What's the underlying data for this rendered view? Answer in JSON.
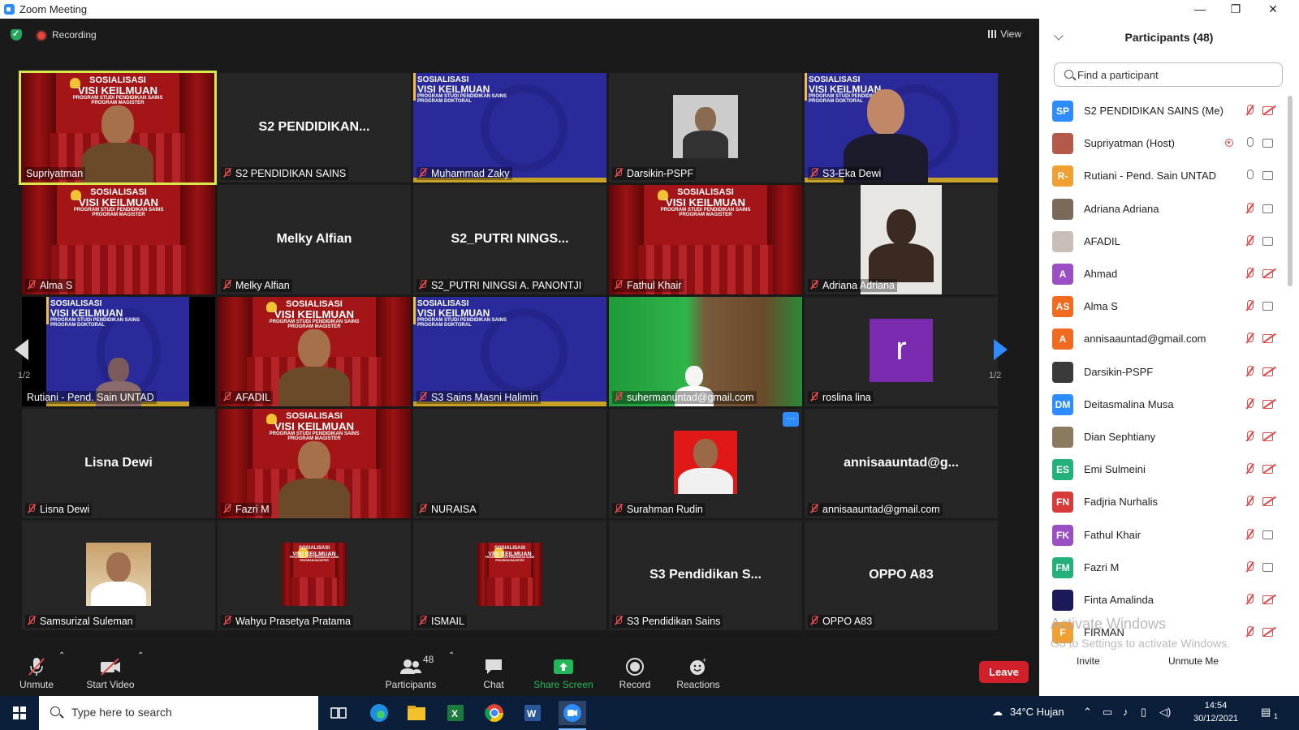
{
  "window": {
    "title": "Zoom Meeting"
  },
  "topbar": {
    "recording": "Recording",
    "view": "View"
  },
  "gallery": {
    "page_left": "1/2",
    "page_right": "1/2",
    "tiles": [
      {
        "name": "Supriyatman",
        "big": "",
        "kind": "banner-person"
      },
      {
        "name": "S2 PENDIDIKAN SAINS",
        "big": "S2  PENDIDIKAN...",
        "kind": "text"
      },
      {
        "name": "Muhammad Zaky",
        "big": "",
        "kind": "blue"
      },
      {
        "name": "Darsikin-PSPF",
        "big": "",
        "kind": "person-small"
      },
      {
        "name": "S3-Eka Dewi",
        "big": "",
        "kind": "blue-person"
      },
      {
        "name": "Alma S",
        "big": "",
        "kind": "banner"
      },
      {
        "name": "Melky Alfian",
        "big": "Melky Alfian",
        "kind": "text"
      },
      {
        "name": "S2_PUTRI NINGSI A. PANONTJI",
        "big": "S2_PUTRI  NINGS...",
        "kind": "text"
      },
      {
        "name": "Fathul Khair",
        "big": "",
        "kind": "banner"
      },
      {
        "name": "Adriana Adriana",
        "big": "",
        "kind": "person-portrait"
      },
      {
        "name": "Rutiani - Pend. Sain UNTAD",
        "big": "",
        "kind": "blue-small"
      },
      {
        "name": "AFADIL",
        "big": "",
        "kind": "banner-person"
      },
      {
        "name": "S3 Sains Masni Halimin",
        "big": "",
        "kind": "blue"
      },
      {
        "name": "suhermanuntad@gmail.com",
        "big": "",
        "kind": "green"
      },
      {
        "name": "roslina lina",
        "big": "",
        "kind": "avatar"
      },
      {
        "name": "Lisna Dewi",
        "big": "Lisna Dewi",
        "kind": "text"
      },
      {
        "name": "Fazri M",
        "big": "",
        "kind": "banner-person"
      },
      {
        "name": "NURAISA",
        "big": "",
        "kind": "empty"
      },
      {
        "name": "Surahman Rudin",
        "big": "",
        "kind": "photo-red"
      },
      {
        "name": "annisaauntad@gmail.com",
        "big": "annisaauntad@g...",
        "kind": "text"
      },
      {
        "name": "Samsurizal Suleman",
        "big": "",
        "kind": "photo-white"
      },
      {
        "name": "Wahyu Prasetya Pratama",
        "big": "",
        "kind": "banner-small"
      },
      {
        "name": "ISMAIL",
        "big": "",
        "kind": "banner-small"
      },
      {
        "name": "S3 Pendidikan Sains",
        "big": "S3  Pendidikan S...",
        "kind": "text"
      },
      {
        "name": "OPPO A83",
        "big": "OPPO A83",
        "kind": "text"
      }
    ],
    "banner_title": "SOSIALISASI",
    "banner_subtitle": "VISI KEILMUAN",
    "banner_prog": "PROGRAM STUDI PENDIDIKAN SAINS",
    "banner_mag": "PROGRAM MAGISTER",
    "banner_dok": "PROGRAM DOKTORAL",
    "avatar_letter": "r",
    "more_dots": "···"
  },
  "toolbar": {
    "unmute": "Unmute",
    "start_video": "Start Video",
    "participants": "Participants",
    "participants_count": "48",
    "chat": "Chat",
    "share_screen": "Share Screen",
    "record": "Record",
    "reactions": "Reactions",
    "leave": "Leave"
  },
  "panel": {
    "title": "Participants (48)",
    "search_placeholder": "Find a participant",
    "invite": "Invite",
    "unmute_me": "Unmute Me",
    "watermark_1": "Activate Windows",
    "watermark_2": "Go to Settings to activate Windows.",
    "participants": [
      {
        "initials": "SP",
        "name": "S2 PENDIDIKAN SAINS (Me)",
        "color": "#2d8cff",
        "mic": "off",
        "cam": "off",
        "rec": false
      },
      {
        "initials": "",
        "name": "Supriyatman (Host)",
        "color": "#b55a4a",
        "mic": "on",
        "cam": "on",
        "rec": true
      },
      {
        "initials": "R-",
        "name": "Rutiani - Pend. Sain UNTAD",
        "color": "#f0a030",
        "mic": "on",
        "cam": "on",
        "rec": false
      },
      {
        "initials": "",
        "name": "Adriana Adriana",
        "color": "#7a6a5a",
        "mic": "off",
        "cam": "on",
        "rec": false
      },
      {
        "initials": "",
        "name": "AFADIL",
        "color": "#c8c0b8",
        "mic": "off",
        "cam": "on",
        "rec": false
      },
      {
        "initials": "A",
        "name": "Ahmad",
        "color": "#9b4fc4",
        "mic": "off",
        "cam": "off",
        "rec": false
      },
      {
        "initials": "AS",
        "name": "Alma S",
        "color": "#f06a20",
        "mic": "off",
        "cam": "on",
        "rec": false
      },
      {
        "initials": "A",
        "name": "annisaauntad@gmail.com",
        "color": "#f06a20",
        "mic": "off",
        "cam": "off",
        "rec": false
      },
      {
        "initials": "",
        "name": "Darsikin-PSPF",
        "color": "#3a3a3a",
        "mic": "off",
        "cam": "off",
        "rec": false
      },
      {
        "initials": "DM",
        "name": "Deitasmalina Musa",
        "color": "#2d8cff",
        "mic": "off",
        "cam": "off",
        "rec": false
      },
      {
        "initials": "",
        "name": "Dian Sephtiany",
        "color": "#8a7a60",
        "mic": "off",
        "cam": "off",
        "rec": false
      },
      {
        "initials": "ES",
        "name": "Emi Sulmeini",
        "color": "#23b07a",
        "mic": "off",
        "cam": "off",
        "rec": false
      },
      {
        "initials": "FN",
        "name": "Fadjria Nurhalis",
        "color": "#d83a3a",
        "mic": "off",
        "cam": "off",
        "rec": false
      },
      {
        "initials": "FK",
        "name": "Fathul Khair",
        "color": "#9b4fc4",
        "mic": "off",
        "cam": "on",
        "rec": false
      },
      {
        "initials": "FM",
        "name": "Fazri M",
        "color": "#23b07a",
        "mic": "off",
        "cam": "on",
        "rec": false
      },
      {
        "initials": "",
        "name": "Finta Amalinda",
        "color": "#1a1a5a",
        "mic": "off",
        "cam": "off",
        "rec": false
      },
      {
        "initials": "F",
        "name": "FIRMAN",
        "color": "#f0a030",
        "mic": "off",
        "cam": "off",
        "rec": false
      }
    ]
  },
  "taskbar": {
    "search_placeholder": "Type here to search",
    "weather": "34°C  Hujan",
    "time": "14:54",
    "date": "30/12/2021",
    "notif_count": "1"
  },
  "colors": {
    "accent": "#2d8cff",
    "leave": "#d1202a",
    "active_speaker": "#d9e84a",
    "share": "#23b75a"
  }
}
